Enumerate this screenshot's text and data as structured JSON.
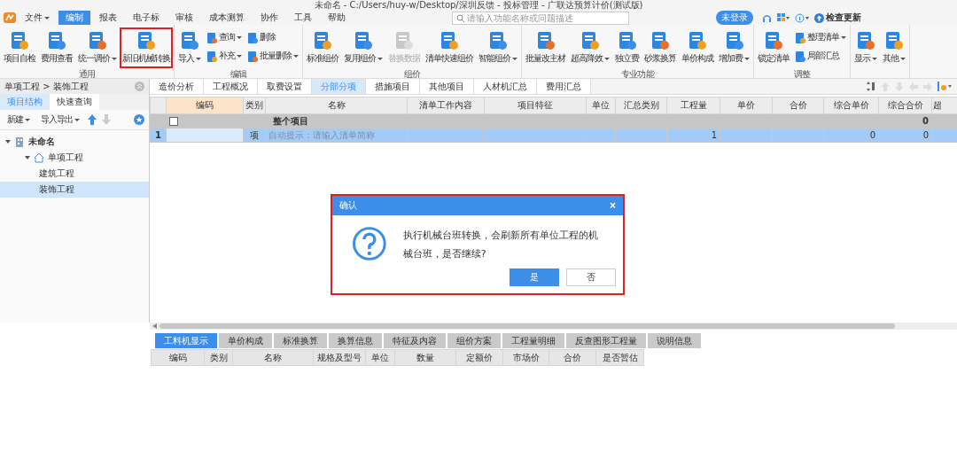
{
  "window": {
    "title": "未命名 - C:/Users/huy-w/Desktop/深圳反馈 - 投标管理 - 广联达预算计价(测试版)"
  },
  "menus": [
    {
      "label": "文件",
      "dropdown": true,
      "selected": false
    },
    {
      "label": "编制",
      "dropdown": false,
      "selected": true
    },
    {
      "label": "报表",
      "dropdown": false,
      "selected": false
    },
    {
      "label": "电子标",
      "dropdown": false,
      "selected": false
    },
    {
      "label": "审核",
      "dropdown": false,
      "selected": false
    },
    {
      "label": "成本测算",
      "dropdown": false,
      "selected": false
    },
    {
      "label": "协作",
      "dropdown": false,
      "selected": false
    },
    {
      "label": "工具",
      "dropdown": false,
      "selected": false
    },
    {
      "label": "帮助",
      "dropdown": false,
      "selected": false
    }
  ],
  "search": {
    "placeholder": "请输入功能名称或问题描述"
  },
  "login_button": "未登录",
  "update_button": "检查更新",
  "ribbon": [
    {
      "label": "通用",
      "items": [
        {
          "kind": "large",
          "label": "项目自检",
          "dropdown": false,
          "disabled": false,
          "highlighted": false
        },
        {
          "kind": "large",
          "label": "费用查看",
          "dropdown": false,
          "disabled": false,
          "highlighted": false
        },
        {
          "kind": "large",
          "label": "统一调价",
          "dropdown": true,
          "disabled": false,
          "highlighted": false
        },
        {
          "kind": "large",
          "label": "新旧机械转换",
          "dropdown": false,
          "disabled": false,
          "highlighted": true
        }
      ]
    },
    {
      "label": "编辑",
      "items": [
        {
          "kind": "large",
          "label": "导入",
          "dropdown": true,
          "disabled": false,
          "highlighted": false
        },
        {
          "kind": "small",
          "label": "查询",
          "dropdown": true,
          "disabled": false,
          "highlighted": false
        },
        {
          "kind": "small",
          "label": "补充",
          "dropdown": true,
          "disabled": false,
          "highlighted": false
        },
        {
          "kind": "small",
          "label": "删除",
          "dropdown": false,
          "disabled": false,
          "highlighted": false
        },
        {
          "kind": "small",
          "label": "批量删除",
          "dropdown": true,
          "disabled": false,
          "highlighted": false
        }
      ]
    },
    {
      "label": "组价",
      "items": [
        {
          "kind": "large",
          "label": "标准组价",
          "dropdown": false,
          "disabled": false,
          "highlighted": false
        },
        {
          "kind": "large",
          "label": "复用组价",
          "dropdown": true,
          "disabled": false,
          "highlighted": false
        },
        {
          "kind": "large",
          "label": "替换数据",
          "dropdown": false,
          "disabled": true,
          "highlighted": false
        },
        {
          "kind": "large",
          "label": "清单快速组价",
          "dropdown": false,
          "disabled": false,
          "highlighted": false
        },
        {
          "kind": "large",
          "label": "智能组价",
          "dropdown": true,
          "disabled": false,
          "highlighted": false
        }
      ]
    },
    {
      "label": "专业功能",
      "items": [
        {
          "kind": "large",
          "label": "批量改主材",
          "dropdown": false,
          "disabled": false,
          "highlighted": false
        },
        {
          "kind": "large",
          "label": "超高降效",
          "dropdown": true,
          "disabled": false,
          "highlighted": false
        },
        {
          "kind": "large",
          "label": "独立费",
          "dropdown": false,
          "disabled": false,
          "highlighted": false
        },
        {
          "kind": "large",
          "label": "砂浆换算",
          "dropdown": false,
          "disabled": false,
          "highlighted": false
        },
        {
          "kind": "large",
          "label": "单价构成",
          "dropdown": false,
          "disabled": false,
          "highlighted": false
        },
        {
          "kind": "large",
          "label": "增加费",
          "dropdown": true,
          "disabled": false,
          "highlighted": false
        }
      ]
    },
    {
      "label": "调整",
      "items": [
        {
          "kind": "large",
          "label": "锁定清单",
          "dropdown": false,
          "disabled": false,
          "highlighted": false
        },
        {
          "kind": "small",
          "label": "整理清单",
          "dropdown": true,
          "disabled": false,
          "highlighted": false
        },
        {
          "kind": "small",
          "label": "局部汇总",
          "dropdown": false,
          "disabled": false,
          "highlighted": false
        }
      ]
    },
    {
      "items": [
        {
          "kind": "large",
          "label": "显示",
          "dropdown": true,
          "disabled": false,
          "highlighted": false
        },
        {
          "kind": "large",
          "label": "其他",
          "dropdown": true,
          "disabled": false,
          "highlighted": false
        }
      ]
    }
  ],
  "sidebar": {
    "breadcrumb": "单项工程 > 装饰工程",
    "tabs": [
      {
        "label": "项目结构",
        "selected": true
      },
      {
        "label": "快速查询",
        "selected": false
      }
    ],
    "toolbar": [
      {
        "label": "新建",
        "dropdown": true
      },
      {
        "label": "导入导出",
        "dropdown": true
      }
    ],
    "tree": [
      {
        "label": "未命名",
        "expanded": true,
        "selected": false,
        "children": [
          {
            "label": "单项工程",
            "expanded": true,
            "selected": false,
            "children": [
              {
                "label": "建筑工程",
                "selected": false
              },
              {
                "label": "装饰工程",
                "selected": true
              }
            ]
          }
        ]
      }
    ]
  },
  "tabs": [
    {
      "label": "造价分析",
      "selected": false
    },
    {
      "label": "工程概况",
      "selected": false
    },
    {
      "label": "取费设置",
      "selected": false
    },
    {
      "label": "分部分项",
      "selected": true
    },
    {
      "label": "措施项目",
      "selected": false
    },
    {
      "label": "其他项目",
      "selected": false
    },
    {
      "label": "人材机汇总",
      "selected": false
    },
    {
      "label": "费用汇总",
      "selected": false
    }
  ],
  "table": {
    "columns": [
      {
        "label": "编码",
        "selected": true
      },
      {
        "label": "类别",
        "selected": false
      },
      {
        "label": "名称",
        "selected": false
      },
      {
        "label": "清单工作内容",
        "selected": false
      },
      {
        "label": "项目特征",
        "selected": false
      },
      {
        "label": "单位",
        "selected": false
      },
      {
        "label": "汇总类别",
        "selected": false
      },
      {
        "label": "工程量",
        "selected": false
      },
      {
        "label": "单价",
        "selected": false
      },
      {
        "label": "合价",
        "selected": false
      },
      {
        "label": "综合单价",
        "selected": false
      },
      {
        "label": "综合合价",
        "selected": false
      },
      {
        "label": "超",
        "selected": false
      }
    ],
    "rows": [
      {
        "kind": "group",
        "number": "",
        "cells": [
          "",
          "",
          "整个项目",
          "",
          "",
          "",
          "",
          "",
          "",
          "",
          "",
          "0",
          ""
        ],
        "selected": false
      },
      {
        "kind": "item",
        "number": "1",
        "cells": [
          "",
          "项",
          "自动提示：请输入清单简称",
          "",
          "",
          "",
          "",
          "1",
          "",
          "",
          "0",
          "0",
          ""
        ],
        "selected": true
      }
    ]
  },
  "bottom_tabs": [
    {
      "label": "工料机显示",
      "selected": true
    },
    {
      "label": "单价构成",
      "selected": false
    },
    {
      "label": "标准换算",
      "selected": false
    },
    {
      "label": "换算信息",
      "selected": false
    },
    {
      "label": "特征及内容",
      "selected": false
    },
    {
      "label": "组价方案",
      "selected": false
    },
    {
      "label": "工程量明细",
      "selected": false
    },
    {
      "label": "反查图形工程量",
      "selected": false
    },
    {
      "label": "说明信息",
      "selected": false
    }
  ],
  "bottom_table": {
    "columns": [
      "编码",
      "类别",
      "名称",
      "规格及型号",
      "单位",
      "数量",
      "定额价",
      "市场价",
      "合价",
      "是否暂估"
    ]
  },
  "dialog": {
    "title": "确认",
    "close": "×",
    "message": "执行机械台班转换，会刷新所有单位工程的机械台班，是否继续?",
    "buttons": [
      {
        "label": "是",
        "primary": true
      },
      {
        "label": "否",
        "primary": false
      }
    ]
  }
}
